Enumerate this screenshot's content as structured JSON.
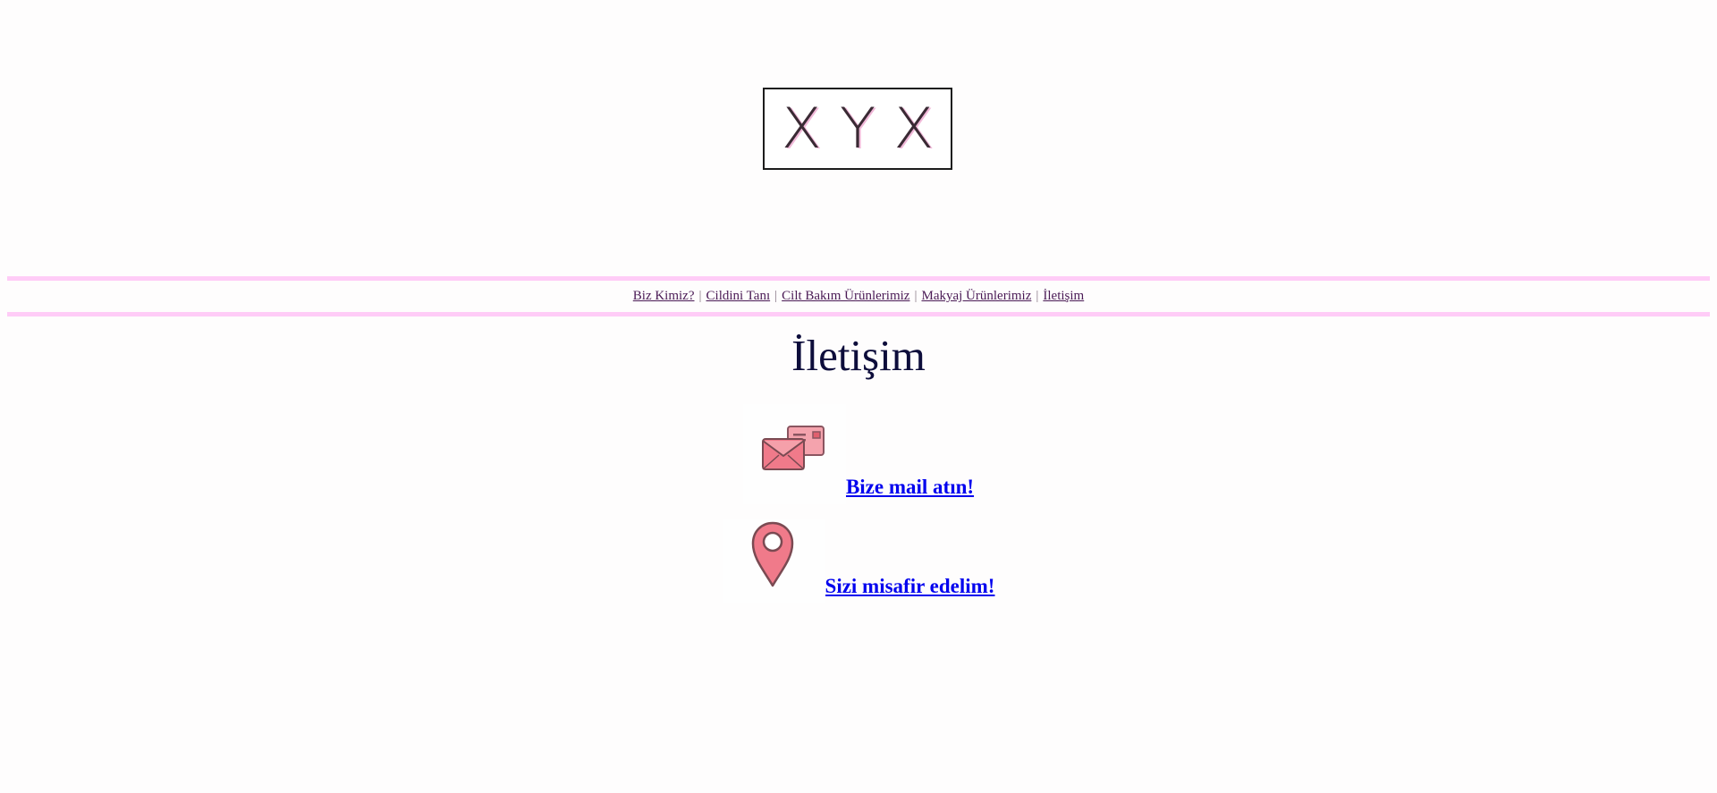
{
  "logo": {
    "text": "XYX"
  },
  "nav": {
    "items": [
      {
        "label": "Biz Kimiz?"
      },
      {
        "label": "Cildini Tanı"
      },
      {
        "label": "Cilt Bakım Ürünlerimiz"
      },
      {
        "label": "Makyaj Ürünlerimiz"
      },
      {
        "label": "İletişim"
      }
    ],
    "separator": "|"
  },
  "heading": "İletişim",
  "contact": {
    "mail": {
      "label": "Bize mail atın!",
      "icon": "mail-envelope-icon"
    },
    "location": {
      "label": "Sizi misafir edelim!",
      "icon": "map-pin-icon"
    }
  },
  "colors": {
    "nav_border": "#ffccf7",
    "link": "#0000ee",
    "heading": "#0d0d3b",
    "icon_pink": "#f07a8a"
  }
}
